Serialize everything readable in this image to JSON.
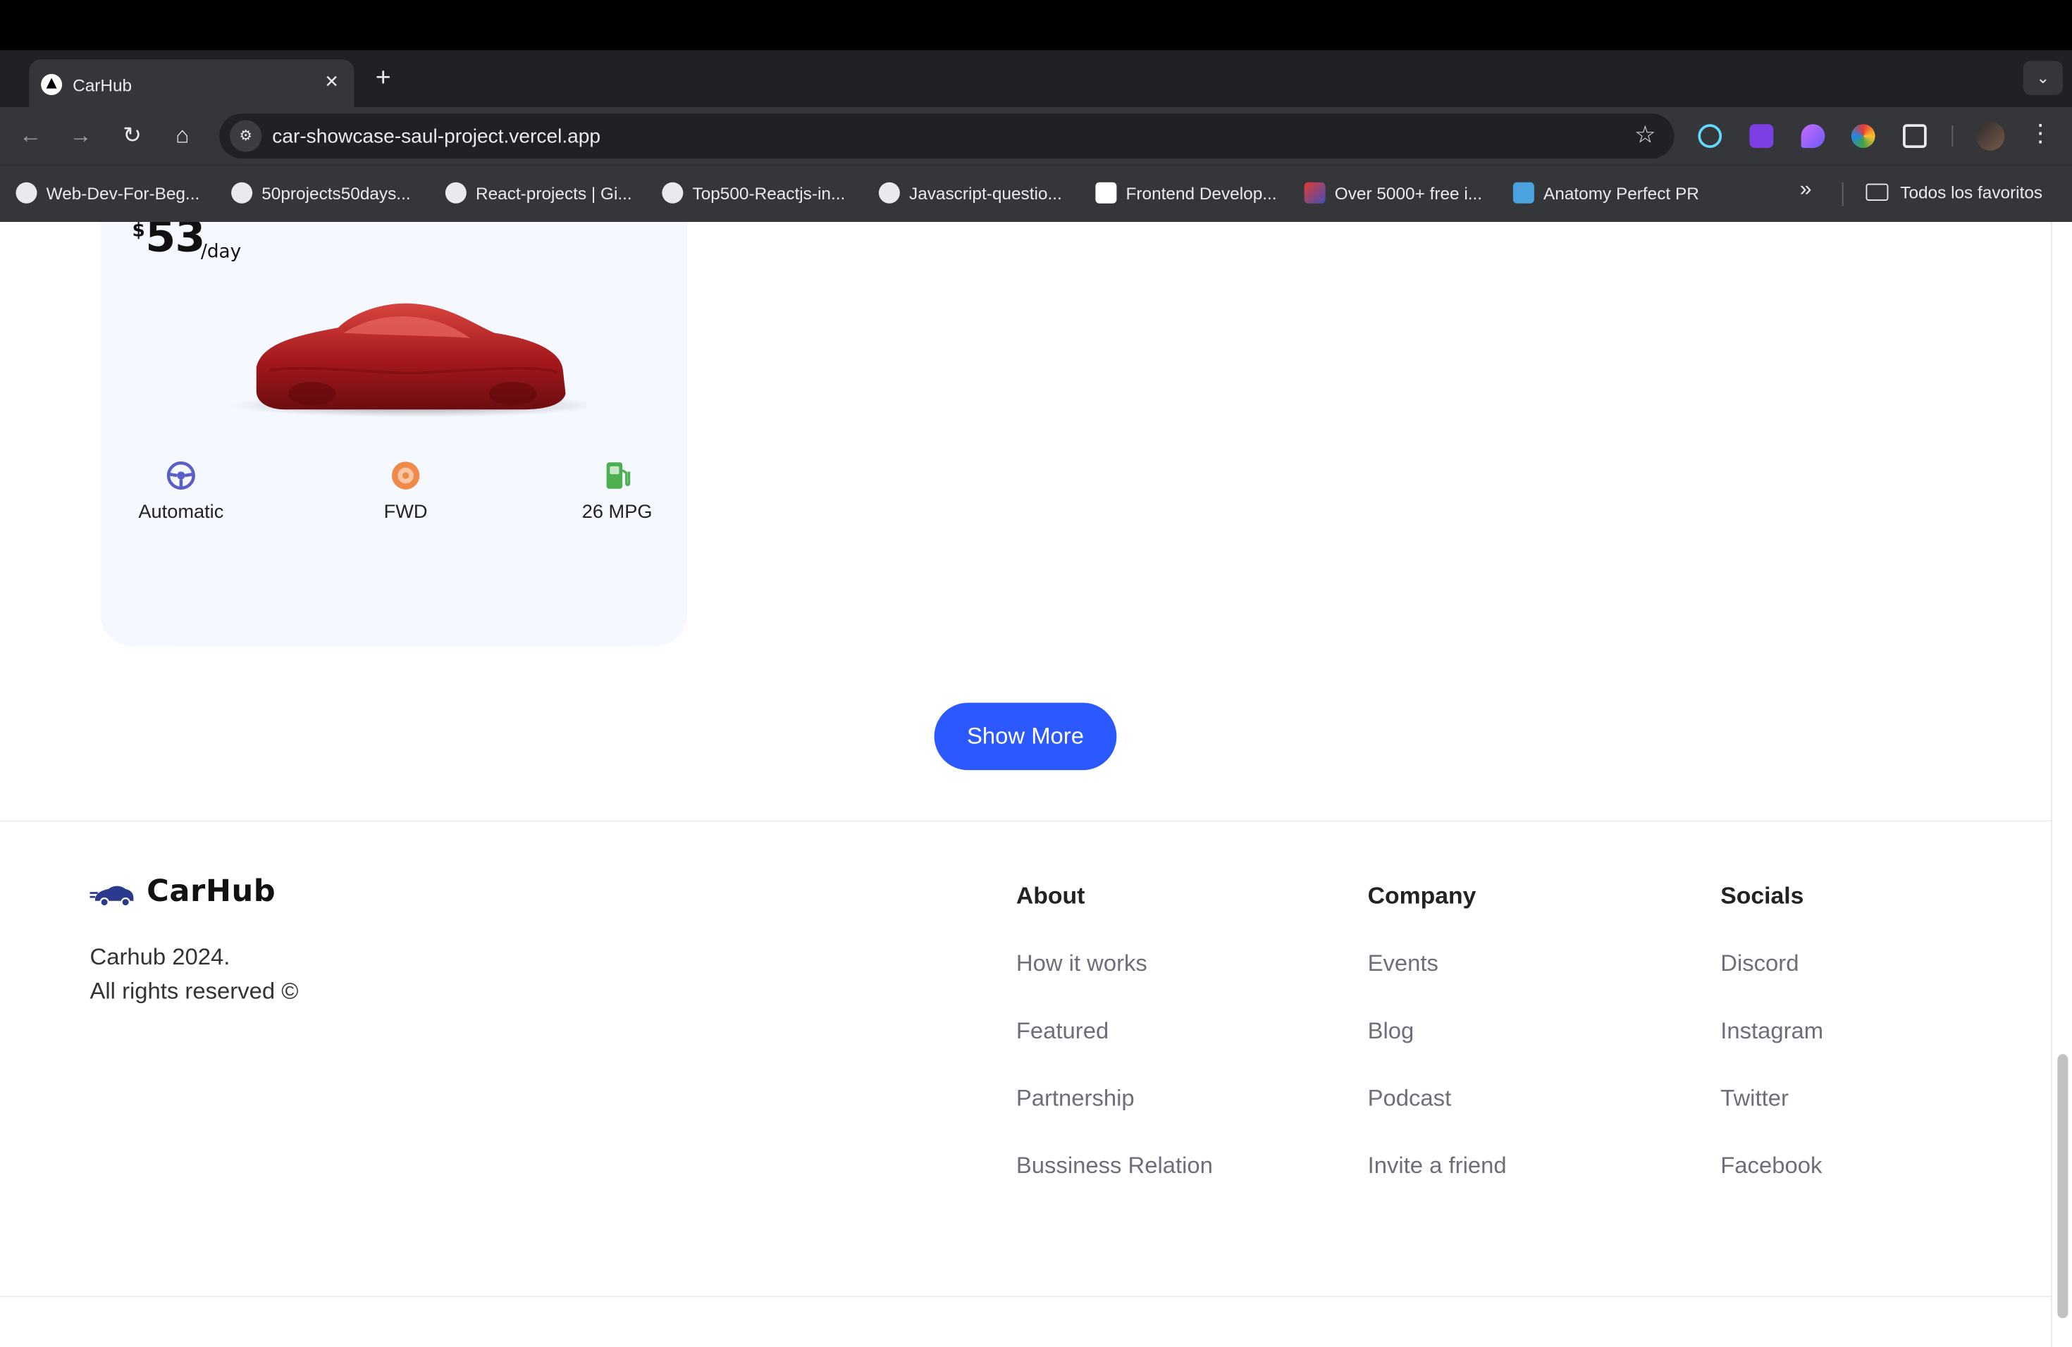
{
  "browser": {
    "tab_title": "CarHub",
    "url": "car-showcase-saul-project.vercel.app",
    "bookmarks": [
      "Web-Dev-For-Beg...",
      "50projects50days...",
      "React-projects | Gi...",
      "Top500-Reactjs-in...",
      "Javascript-questio...",
      "Frontend Develop...",
      "Over 5000+ free i...",
      "Anatomy Perfect PR"
    ],
    "all_bookmarks": "Todos los favoritos",
    "icons": {
      "back": "arrow-left-icon",
      "forward": "arrow-right-icon",
      "reload": "reload-icon",
      "home": "home-icon",
      "bookmark_star": "star-icon",
      "menu": "kebab-menu-icon"
    }
  },
  "car_card": {
    "currency": "$",
    "price": "53",
    "price_unit": "/day",
    "specs": [
      {
        "label": "Automatic",
        "icon": "steering-wheel-icon",
        "color": "#5a5fc7"
      },
      {
        "label": "FWD",
        "icon": "tire-icon",
        "color": "#f08a4b"
      },
      {
        "label": "26 MPG",
        "icon": "gas-pump-icon",
        "color": "#4caf50"
      }
    ],
    "car_color": "#b51f24"
  },
  "show_more": "Show More",
  "footer": {
    "brand": "CarHub",
    "copyright_line1": "Carhub 2024.",
    "copyright_line2": "All rights reserved ©",
    "columns": [
      {
        "title": "About",
        "links": [
          "How it works",
          "Featured",
          "Partnership",
          "Bussiness Relation"
        ]
      },
      {
        "title": "Company",
        "links": [
          "Events",
          "Blog",
          "Podcast",
          "Invite a friend"
        ]
      },
      {
        "title": "Socials",
        "links": [
          "Discord",
          "Instagram",
          "Twitter",
          "Facebook"
        ]
      }
    ]
  },
  "colors": {
    "primary": "#2b59ff",
    "card_bg": "#f5f8ff"
  }
}
